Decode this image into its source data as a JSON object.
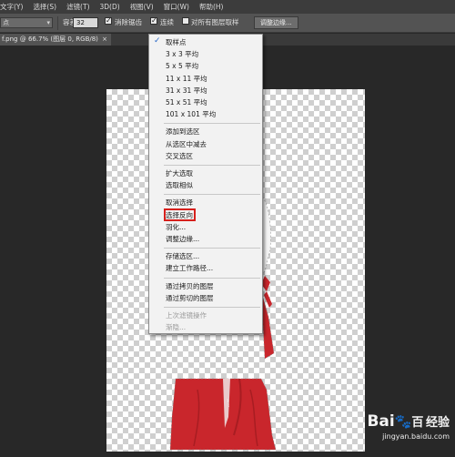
{
  "menubar": {
    "items": [
      "文字(Y)",
      "选择(S)",
      "滤镜(T)",
      "3D(D)",
      "视图(V)",
      "窗口(W)",
      "帮助(H)"
    ]
  },
  "options": {
    "select_value": "点",
    "tolerance_label": "容差：",
    "tolerance_value": "32",
    "antialias_label": "消除锯齿",
    "contiguous_label": "连续",
    "sample_all_label": "对所有图层取样",
    "refine_edge_button": "调整边缘..."
  },
  "document_tab": {
    "title": "f.png @ 66.7% (图层 0, RGB/8)",
    "close": "×"
  },
  "context_menu": {
    "checked_icon": "checkmark-icon",
    "groups": [
      [
        "取样点",
        "3 x 3 平均",
        "5 x 5 平均",
        "11 x 11 平均",
        "31 x 31 平均",
        "51 x 51 平均",
        "101 x 101 平均"
      ],
      [
        "添加到选区",
        "从选区中减去",
        "交叉选区"
      ],
      [
        "扩大选取",
        "选取相似"
      ],
      [
        "取消选择",
        "选择反向",
        "羽化...",
        "调整边缘..."
      ],
      [
        "存储选区...",
        "建立工作路径..."
      ],
      [
        "通过拷贝的图层",
        "通过剪切的图层"
      ],
      [
        "上次滤镜操作",
        "渐隐..."
      ]
    ],
    "highlighted": "选择反向",
    "disabled": [
      "上次滤镜操作",
      "渐隐..."
    ]
  },
  "watermark": {
    "logo": "Bai",
    "paw": "paw-icon",
    "logo2": "百",
    "brand_cn": "经验",
    "url": "jingyan.baidu.com"
  },
  "colors": {
    "dress_red": "#c9262c",
    "highlight_red": "#d6201c",
    "menu_bg": "#f2f2f2"
  }
}
